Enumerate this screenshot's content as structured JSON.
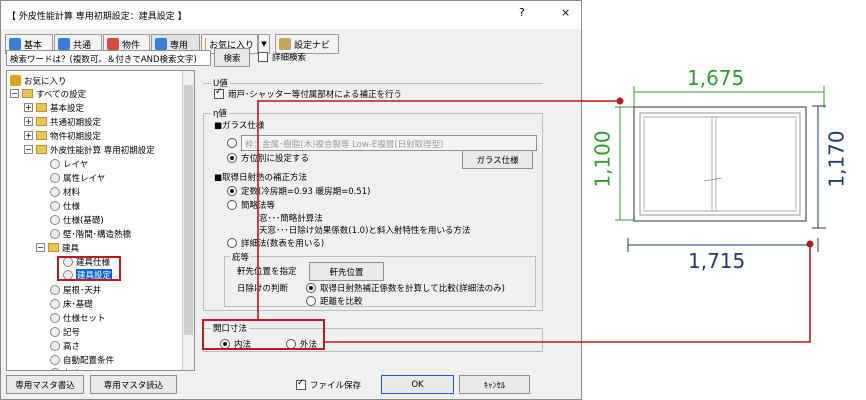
{
  "dialog": {
    "title": "【 外皮性能計算 専用初期設定：建具設定 】",
    "help_label": "?",
    "close_label": "×",
    "toolbar": [
      {
        "label": "基本",
        "icon": "basic-icon",
        "color": "#3b7dd8"
      },
      {
        "label": "共通",
        "icon": "common-icon",
        "color": "#3b7dd8"
      },
      {
        "label": "物件",
        "icon": "property-icon",
        "color": "#d84a3b"
      },
      {
        "label": "専用",
        "icon": "dedicated-icon",
        "color": "#3b7dd8"
      },
      {
        "label": "お気に入り",
        "icon": "favorite-icon",
        "color": "#e0a020"
      }
    ],
    "dropdown_arrow": "▼",
    "nav_button": "設定ナビ",
    "search": {
      "placeholder": "検索ワードは？(複数可。＆付きでAND検索文字)",
      "button": "検索",
      "detail_label": "詳細検索"
    },
    "tree": [
      {
        "label": "お気に入り",
        "indent": 0,
        "kind": "fav"
      },
      {
        "label": "すべての設定",
        "indent": 0,
        "kind": "folder",
        "exp": "−"
      },
      {
        "label": "基本設定",
        "indent": 1,
        "kind": "folder",
        "exp": "+"
      },
      {
        "label": "共通初期設定",
        "indent": 1,
        "kind": "folder",
        "exp": "+"
      },
      {
        "label": "物件初期設定",
        "indent": 1,
        "kind": "folder",
        "exp": "+"
      },
      {
        "label": "外皮性能計算 専用初期設定",
        "indent": 1,
        "kind": "folder",
        "exp": "−"
      },
      {
        "label": "レイヤ",
        "indent": 2,
        "kind": "leaf"
      },
      {
        "label": "属性レイヤ",
        "indent": 2,
        "kind": "leaf"
      },
      {
        "label": "材料",
        "indent": 2,
        "kind": "leaf"
      },
      {
        "label": "仕様",
        "indent": 2,
        "kind": "leaf"
      },
      {
        "label": "仕様(基礎)",
        "indent": 2,
        "kind": "leaf"
      },
      {
        "label": "壁･階間･構造熱橋",
        "indent": 2,
        "kind": "leaf"
      },
      {
        "label": "建具",
        "indent": 2,
        "kind": "folder",
        "exp": "−"
      },
      {
        "label": "建具仕様",
        "indent": 3,
        "kind": "leaf"
      },
      {
        "label": "建具設定",
        "indent": 3,
        "kind": "leaf",
        "selected": true
      },
      {
        "label": "屋根･天井",
        "indent": 2,
        "kind": "leaf"
      },
      {
        "label": "床･基礎",
        "indent": 2,
        "kind": "leaf"
      },
      {
        "label": "仕様セット",
        "indent": 2,
        "kind": "leaf"
      },
      {
        "label": "記号",
        "indent": 2,
        "kind": "leaf"
      },
      {
        "label": "高さ",
        "indent": 2,
        "kind": "leaf"
      },
      {
        "label": "自動配置条件",
        "indent": 2,
        "kind": "leaf"
      },
      {
        "label": "丸め",
        "indent": 2,
        "kind": "leaf"
      }
    ],
    "u_value": {
      "group_label": "U値",
      "check_label": "雨戸･シャッター等付属部材による補正を行う",
      "checked": true
    },
    "eta": {
      "group_label": "η値",
      "glass_heading": "■ガラス仕様",
      "glass_option1": "枠：金属･樹脂(木)複合製等 Low-E複層(日射取得型)",
      "glass_option2": "方位別に設定する",
      "glass_button": "ガラス仕様",
      "solar_heading": "■取得日射熱の補正方法",
      "solar_option1": "定数(冷房期=0.93 暖房期=0.51)",
      "solar_option2": "簡略法等",
      "solar_note1": "窓･･･簡略計算法",
      "solar_note2": "天窓･･･日除け効果係数(1.0)と斜入射特性を用いる方法",
      "solar_option3": "詳細法(数表を用いる)"
    },
    "eaves": {
      "group_label": "庇等",
      "pos_label": "軒先位置を指定",
      "pos_button": "軒先位置",
      "judge_label": "日除けの判断",
      "judge_option1": "取得日射熱補正係数を計算して比較(詳細法のみ)",
      "judge_option2": "距離を比較"
    },
    "opening": {
      "group_label": "開口寸法",
      "option_inner": "内法",
      "option_outer": "外法",
      "selected": "inner"
    },
    "footer": {
      "read_button": "専用マスタ読込",
      "write_button": "専用マスタ書込",
      "save_label": "ファイル保存",
      "ok_button": "OK",
      "cancel_button": "ｷｬﾝｾﾙ"
    }
  },
  "drawing": {
    "inner_width": "1,675",
    "outer_width": "1,715",
    "inner_height": "1,100",
    "outer_height": "1,170",
    "inner_color": "#2e9d2e",
    "outer_color": "#1f3b6e",
    "callout_color": "#c0181f"
  }
}
